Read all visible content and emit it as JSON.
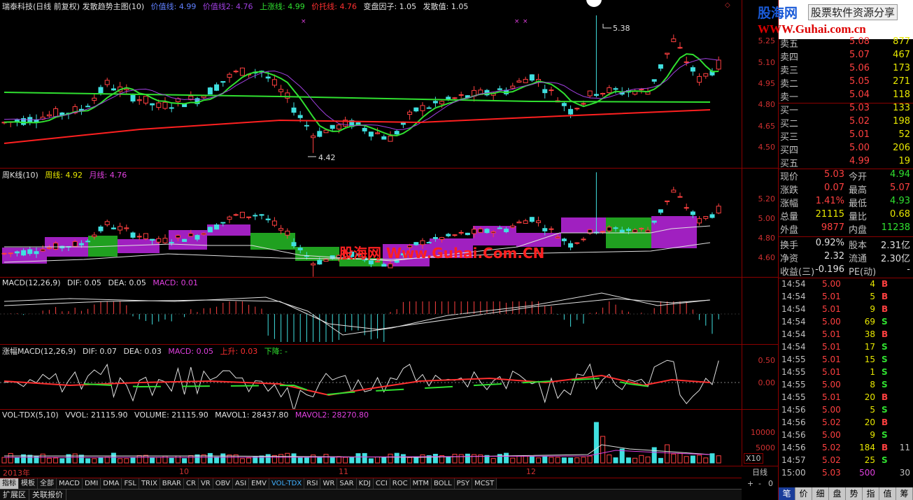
{
  "main": {
    "title": "瑞泰科技(日线 前复权) 发散趋势主图(10)",
    "items": [
      {
        "label": "价值线: 4.99",
        "color": "#6080ff"
      },
      {
        "label": "价值线2: 4.76",
        "color": "#a040e0"
      },
      {
        "label": "上涨线: 4.99",
        "color": "#30e030"
      },
      {
        "label": "价托线: 4.76",
        "color": "#ff3030"
      },
      {
        "label": "变盘因子: 1.05",
        "color": "#e0e0e0"
      },
      {
        "label": "发散值: 1.05",
        "color": "#e0e0e0"
      }
    ],
    "axis": [
      "5.25",
      "5.10",
      "4.95",
      "4.80",
      "4.65",
      "4.50"
    ],
    "high_label": "5.38",
    "low_label": "4.42"
  },
  "weekly": {
    "title": "周K线(10)",
    "items": [
      {
        "label": "周线: 4.92",
        "color": "#e8e800"
      },
      {
        "label": "月线: 4.76",
        "color": "#e040e0"
      }
    ],
    "axis": [
      "5.20",
      "5.00",
      "4.80",
      "4.60"
    ]
  },
  "macd": {
    "title": "MACD(12,26,9)",
    "items": [
      {
        "label": "DIF: 0.05",
        "color": "#e0e0e0"
      },
      {
        "label": "DEA: 0.05",
        "color": "#e0e0e0"
      },
      {
        "label": "MACD: 0.01",
        "color": "#e040e0"
      }
    ]
  },
  "macd2": {
    "title": "涨幅MACD(12,26,9)",
    "items": [
      {
        "label": "DIF: 0.07",
        "color": "#e0e0e0"
      },
      {
        "label": "DEA: 0.03",
        "color": "#e0e0e0"
      },
      {
        "label": "MACD: 0.05",
        "color": "#e040e0"
      },
      {
        "label": "上升: 0.03",
        "color": "#ff3030"
      },
      {
        "label": "下降: -",
        "color": "#30e030"
      }
    ],
    "axis": [
      "0.50",
      "0.00"
    ]
  },
  "vol": {
    "title": "VOL-TDX(5,10)",
    "items": [
      {
        "label": "VVOL: 21115.90",
        "color": "#e0e0e0"
      },
      {
        "label": "VOLUME: 21115.90",
        "color": "#e0e0e0"
      },
      {
        "label": "MAVOL1: 28437.80",
        "color": "#e0e0e0"
      },
      {
        "label": "MAVOL2: 28270.80",
        "color": "#e040e0"
      }
    ],
    "axis": [
      "10000",
      "5000"
    ],
    "unit": "X10"
  },
  "dates": [
    "2013年",
    "10",
    "11",
    "12"
  ],
  "day_type": "日线",
  "tabs": [
    "指标",
    "模板",
    "全部",
    "MACD",
    "DMI",
    "DMA",
    "FSL",
    "TRIX",
    "BRAR",
    "CR",
    "VR",
    "OBV",
    "ASI",
    "EMV",
    "VOL-TDX",
    "RSI",
    "WR",
    "SAR",
    "KDJ",
    "CCI",
    "ROC",
    "MTM",
    "BOLL",
    "PSY",
    "MCST"
  ],
  "bottom_buttons": [
    "扩展区",
    "关联报价"
  ],
  "zoom_buttons": [
    "+",
    "-",
    "0"
  ],
  "logo": {
    "line1": "股海网",
    "line1b": "股票软件资源分享",
    "line2": "WWW.Guhai.com.cn"
  },
  "watermark": "股海网 Www.Guhai.Com.CN",
  "order_book": [
    {
      "label": "卖五",
      "price": "5.08",
      "vol": "877"
    },
    {
      "label": "卖四",
      "price": "5.07",
      "vol": "467"
    },
    {
      "label": "卖三",
      "price": "5.06",
      "vol": "173"
    },
    {
      "label": "卖二",
      "price": "5.05",
      "vol": "271"
    },
    {
      "label": "卖一",
      "price": "5.04",
      "vol": "118"
    },
    {
      "label": "买一",
      "price": "5.03",
      "vol": "133"
    },
    {
      "label": "买二",
      "price": "5.02",
      "vol": "198"
    },
    {
      "label": "买三",
      "price": "5.01",
      "vol": "52"
    },
    {
      "label": "买四",
      "price": "5.00",
      "vol": "206"
    },
    {
      "label": "买五",
      "price": "4.99",
      "vol": "19"
    }
  ],
  "quote": [
    {
      "l1": "现价",
      "v1": "5.03",
      "c1": "red",
      "l2": "今开",
      "v2": "4.94",
      "c2": "green"
    },
    {
      "l1": "涨跌",
      "v1": "0.07",
      "c1": "red",
      "l2": "最高",
      "v2": "5.07",
      "c2": "red"
    },
    {
      "l1": "涨幅",
      "v1": "1.41%",
      "c1": "red",
      "l2": "最低",
      "v2": "4.93",
      "c2": "green"
    },
    {
      "l1": "总量",
      "v1": "21115",
      "c1": "yellow",
      "l2": "量比",
      "v2": "0.68",
      "c2": "yellow"
    },
    {
      "l1": "外盘",
      "v1": "9877",
      "c1": "red",
      "l2": "内盘",
      "v2": "11238",
      "c2": "green"
    },
    {
      "l1": "换手",
      "v1": "0.92%",
      "c1": "white",
      "l2": "股本",
      "v2": "2.31亿",
      "c2": "white"
    },
    {
      "l1": "净资",
      "v1": "2.32",
      "c1": "white",
      "l2": "流通",
      "v2": "2.30亿",
      "c2": "white"
    },
    {
      "l1": "收益(三)",
      "v1": "-0.196",
      "c1": "white",
      "l2": "PE(动)",
      "v2": "-",
      "c2": "white"
    }
  ],
  "trades": [
    {
      "t": "14:54",
      "p": "5.00",
      "v": "4",
      "s": "B",
      "n": ""
    },
    {
      "t": "14:54",
      "p": "5.01",
      "v": "5",
      "s": "B",
      "n": ""
    },
    {
      "t": "14:54",
      "p": "5.01",
      "v": "9",
      "s": "B",
      "n": ""
    },
    {
      "t": "14:54",
      "p": "5.00",
      "v": "69",
      "s": "S",
      "n": ""
    },
    {
      "t": "14:54",
      "p": "5.01",
      "v": "38",
      "s": "B",
      "n": ""
    },
    {
      "t": "14:54",
      "p": "5.01",
      "v": "17",
      "s": "S",
      "n": ""
    },
    {
      "t": "14:55",
      "p": "5.01",
      "v": "15",
      "s": "S",
      "n": ""
    },
    {
      "t": "14:55",
      "p": "5.01",
      "v": "1",
      "s": "S",
      "n": ""
    },
    {
      "t": "14:55",
      "p": "5.00",
      "v": "8",
      "s": "S",
      "n": ""
    },
    {
      "t": "14:55",
      "p": "5.01",
      "v": "20",
      "s": "B",
      "n": ""
    },
    {
      "t": "14:56",
      "p": "5.00",
      "v": "5",
      "s": "S",
      "n": ""
    },
    {
      "t": "14:56",
      "p": "5.02",
      "v": "20",
      "s": "B",
      "n": ""
    },
    {
      "t": "14:56",
      "p": "5.00",
      "v": "9",
      "s": "S",
      "n": ""
    },
    {
      "t": "14:56",
      "p": "5.02",
      "v": "184",
      "s": "B",
      "n": "11"
    },
    {
      "t": "14:57",
      "p": "5.02",
      "v": "25",
      "s": "S",
      "n": ""
    },
    {
      "t": "15:00",
      "p": "5.03",
      "v": "500",
      "s": "",
      "n": "30"
    }
  ],
  "right_tabs": [
    "笔",
    "价",
    "细",
    "盘",
    "势",
    "指",
    "值",
    "筹"
  ],
  "chart_data": {
    "type": "candlestick",
    "title": "瑞泰科技(日线 前复权)",
    "ylim": [
      4.42,
      5.38
    ],
    "series": [
      {
        "name": "价值线",
        "values": [
          4.99
        ]
      },
      {
        "name": "价值线2",
        "values": [
          4.76
        ]
      },
      {
        "name": "上涨线",
        "values": [
          4.99
        ]
      },
      {
        "name": "价托线",
        "values": [
          4.76
        ]
      }
    ]
  }
}
